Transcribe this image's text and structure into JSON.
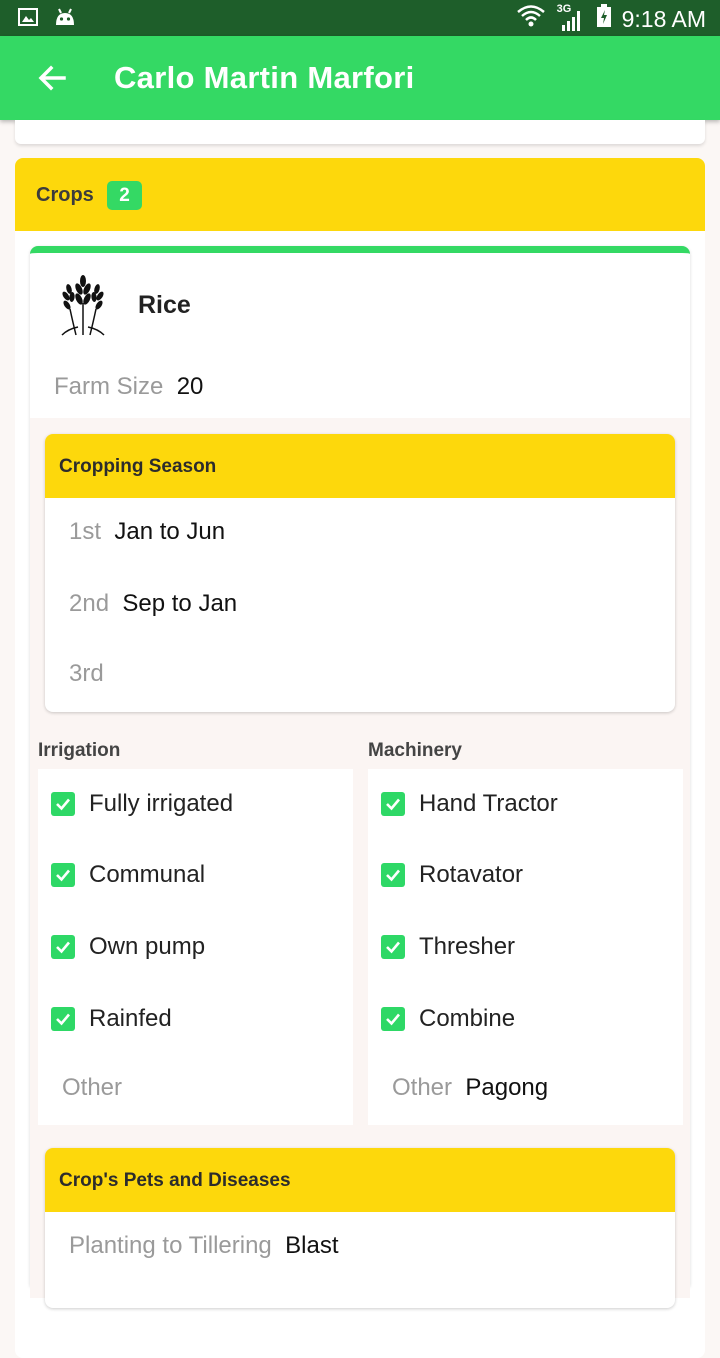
{
  "status_bar": {
    "time": "9:18 AM",
    "network": "3G",
    "icons": [
      "image-icon",
      "android-icon",
      "wifi-icon",
      "signal-icon",
      "battery-icon"
    ]
  },
  "app_bar": {
    "title": "Carlo Martin Marfori",
    "back_icon": "arrow-left-icon"
  },
  "crops": {
    "label": "Crops",
    "count": "2"
  },
  "crop": {
    "name": "Rice",
    "icon": "wheat-icon",
    "farm_size_label": "Farm Size",
    "farm_size_value": "20"
  },
  "cropping_season": {
    "title": "Cropping Season",
    "rows": [
      {
        "label": "1st",
        "value": "Jan to Jun"
      },
      {
        "label": "2nd",
        "value": "Sep to Jan"
      },
      {
        "label": "3rd",
        "value": ""
      }
    ]
  },
  "irrigation": {
    "title": "Irrigation",
    "items": [
      {
        "label": "Fully irrigated",
        "checked": true
      },
      {
        "label": "Communal",
        "checked": true
      },
      {
        "label": "Own pump",
        "checked": true
      },
      {
        "label": "Rainfed",
        "checked": true
      }
    ],
    "other_label": "Other",
    "other_value": ""
  },
  "machinery": {
    "title": "Machinery",
    "items": [
      {
        "label": "Hand Tractor",
        "checked": true
      },
      {
        "label": "Rotavator",
        "checked": true
      },
      {
        "label": "Thresher",
        "checked": true
      },
      {
        "label": "Combine",
        "checked": true
      }
    ],
    "other_label": "Other",
    "other_value": "Pagong"
  },
  "pests": {
    "title": "Crop's Pets and Diseases",
    "rows": [
      {
        "label": "Planting to Tillering",
        "value": "Blast"
      }
    ]
  },
  "colors": {
    "status_bar": "#1e5e2a",
    "app_bar": "#34d964",
    "header_yellow": "#fdd80c",
    "check_green": "#2ed866"
  }
}
